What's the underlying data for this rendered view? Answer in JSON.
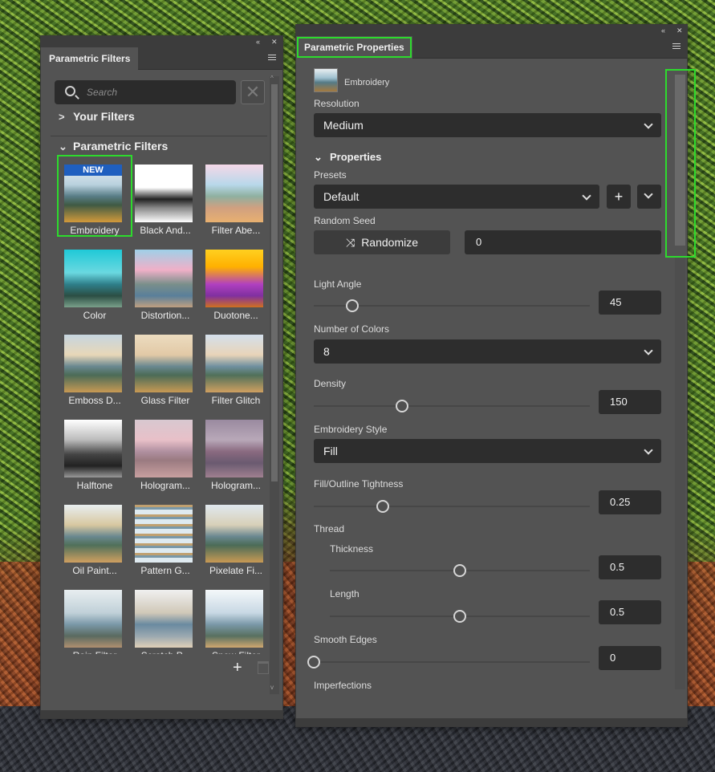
{
  "left_panel": {
    "tab_title": "Parametric Filters",
    "search_placeholder": "Search",
    "your_filters_label": "Your Filters",
    "parametric_filters_label": "Parametric Filters",
    "new_badge": "NEW",
    "tiles": [
      {
        "label": "Embroidery",
        "selected": true,
        "new": true
      },
      {
        "label": "Black And..."
      },
      {
        "label": "Filter Abe..."
      },
      {
        "label": "Color"
      },
      {
        "label": "Distortion..."
      },
      {
        "label": "Duotone..."
      },
      {
        "label": "Emboss D..."
      },
      {
        "label": "Glass Filter"
      },
      {
        "label": "Filter Glitch"
      },
      {
        "label": "Halftone"
      },
      {
        "label": "Hologram..."
      },
      {
        "label": "Hologram..."
      },
      {
        "label": "Oil Paint..."
      },
      {
        "label": "Pattern G..."
      },
      {
        "label": "Pixelate Fi..."
      },
      {
        "label": "Rain Filter"
      },
      {
        "label": "Scratch P..."
      },
      {
        "label": "Snow Filter"
      }
    ],
    "add_icon": "+"
  },
  "right_panel": {
    "tab_title": "Parametric Properties",
    "filter_name": "Embroidery",
    "resolution": {
      "label": "Resolution",
      "value": "Medium"
    },
    "properties_label": "Properties",
    "presets": {
      "label": "Presets",
      "value": "Default"
    },
    "random_seed": {
      "label": "Random Seed",
      "button": "Randomize",
      "value": "0"
    },
    "light_angle": {
      "label": "Light Angle",
      "value": "45",
      "fraction": 0.14
    },
    "number_of_colors": {
      "label": "Number of Colors",
      "value": "8"
    },
    "density": {
      "label": "Density",
      "value": "150",
      "fraction": 0.32
    },
    "embroidery_style": {
      "label": "Embroidery Style",
      "value": "Fill"
    },
    "fill_outline_tightness": {
      "label": "Fill/Outline Tightness",
      "value": "0.25",
      "fraction": 0.25
    },
    "thread": {
      "label": "Thread",
      "thickness": {
        "label": "Thickness",
        "value": "0.5",
        "fraction": 0.5
      },
      "length": {
        "label": "Length",
        "value": "0.5",
        "fraction": 0.5
      }
    },
    "smooth_edges": {
      "label": "Smooth Edges",
      "value": "0",
      "fraction": 0
    },
    "imperfections_label": "Imperfections"
  },
  "colors": {
    "panel_bg": "#535353",
    "field_bg": "#2d2d2d",
    "highlight": "#2ddb2d",
    "badge_blue": "#1f5fbf"
  }
}
